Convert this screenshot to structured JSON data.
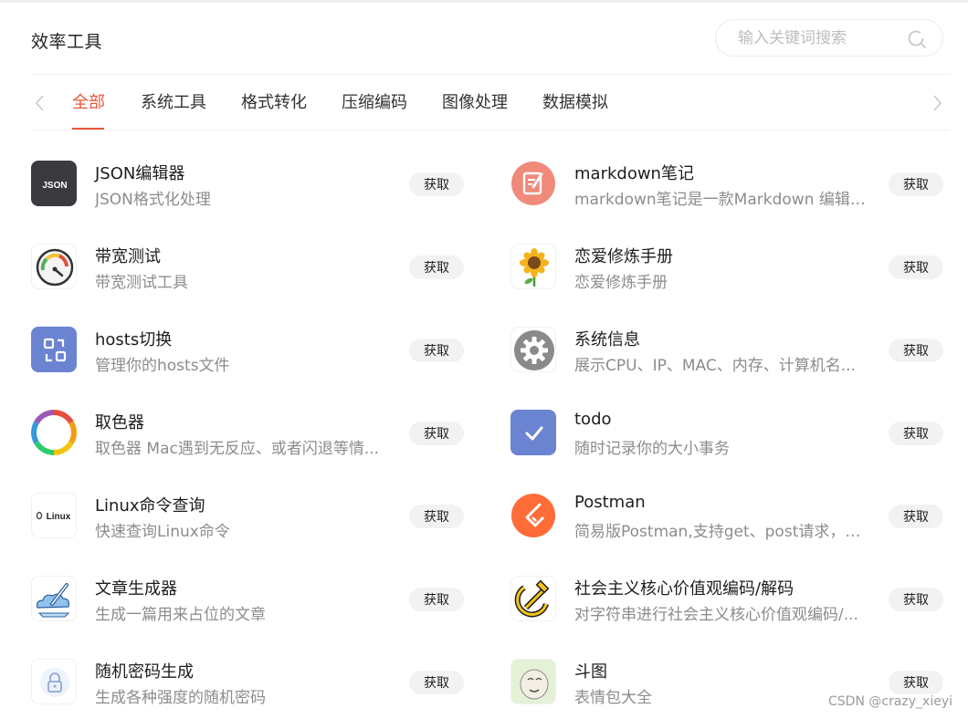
{
  "header": {
    "title": "效率工具",
    "search_placeholder": "输入关键词搜索"
  },
  "tabs": [
    {
      "label": "全部",
      "active": true
    },
    {
      "label": "系统工具",
      "active": false
    },
    {
      "label": "格式转化",
      "active": false
    },
    {
      "label": "压缩编码",
      "active": false
    },
    {
      "label": "图像处理",
      "active": false
    },
    {
      "label": "数据模拟",
      "active": false
    }
  ],
  "colors": {
    "accent": "#e8563b",
    "button_bg": "#f2f2f2"
  },
  "tools": [
    {
      "name": "JSON编辑器",
      "desc": "JSON格式化处理",
      "button": "获取",
      "icon": "json-icon",
      "icon_text": "JSON"
    },
    {
      "name": "markdown笔记",
      "desc": "markdown笔记是一款Markdown 编辑器...",
      "button": "获取",
      "icon": "note-edit-icon"
    },
    {
      "name": "带宽测试",
      "desc": "带宽测试工具",
      "button": "获取",
      "icon": "speedometer-icon"
    },
    {
      "name": "恋爱修炼手册",
      "desc": "恋爱修炼手册",
      "button": "获取",
      "icon": "sunflower-icon"
    },
    {
      "name": "hosts切换",
      "desc": "管理你的hosts文件",
      "button": "获取",
      "icon": "switch-icon"
    },
    {
      "name": "系统信息",
      "desc": "展示CPU、IP、MAC、内存、计算机名...",
      "button": "获取",
      "icon": "gear-icon"
    },
    {
      "name": "取色器",
      "desc": "取色器 Mac遇到无反应、或者闪退等情...",
      "button": "获取",
      "icon": "color-wheel-icon"
    },
    {
      "name": "todo",
      "desc": "随时记录你的大小事务",
      "button": "获取",
      "icon": "checkmark-icon"
    },
    {
      "name": "Linux命令查询",
      "desc": "快速查询Linux命令",
      "button": "获取",
      "icon": "linux-icon",
      "icon_text": "Linux"
    },
    {
      "name": "Postman",
      "desc": "简易版Postman,支持get、post请求，自...",
      "button": "获取",
      "icon": "postman-icon"
    },
    {
      "name": "文章生成器",
      "desc": "生成一篇用来占位的文章",
      "button": "获取",
      "icon": "pencil-cloud-icon"
    },
    {
      "name": "社会主义核心价值观编码/解码",
      "desc": "对字符串进行社会主义核心价值观编码/...",
      "button": "获取",
      "icon": "hammer-sickle-icon"
    },
    {
      "name": "随机密码生成",
      "desc": "生成各种强度的随机密码",
      "button": "获取",
      "icon": "lock-icon"
    },
    {
      "name": "斗图",
      "desc": "表情包大全",
      "button": "获取",
      "icon": "meme-face-icon"
    }
  ],
  "watermark": "CSDN @crazy_xieyi"
}
